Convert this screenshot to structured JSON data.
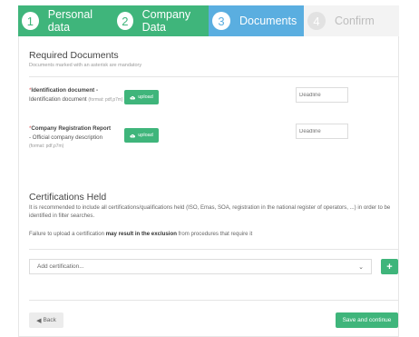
{
  "steps": [
    {
      "number": "1",
      "label": "Personal data",
      "state": "completed"
    },
    {
      "number": "2",
      "label": "Company Data",
      "state": "completed"
    },
    {
      "number": "3",
      "label": "Documents",
      "state": "active"
    },
    {
      "number": "4",
      "label": "Confirm",
      "state": "pending"
    }
  ],
  "colors": {
    "green": "#3fb57b",
    "blue": "#5aaee0",
    "grey": "#f3f3f3"
  },
  "required": {
    "title": "Required Documents",
    "subtitle": "Documents marked with an asterisk are mandatory",
    "documents": [
      {
        "asterisk": "*",
        "name": "Identification document",
        "dash": " -",
        "description": "Identification document",
        "format": "(format: pdf,p7m)",
        "upload_label": "upload",
        "upload_icon": "cloud-upload-icon",
        "deadline_placeholder": "Deadline"
      },
      {
        "asterisk": "*",
        "name": "Company Registration Report",
        "dash": "",
        "description": "- Official company description",
        "format": "(format: pdf,p7m)",
        "upload_label": "upload",
        "upload_icon": "cloud-upload-icon",
        "deadline_placeholder": "Deadline"
      }
    ]
  },
  "certifications": {
    "title": "Certifications Held",
    "recommendation": "It is recommended to include all certifications/qualifications held (ISO, Emas, SOA, registration in the national register of operators, ...) in order to be identified in filter searches.",
    "warning_prefix": "Failure to upload a certification ",
    "warning_bold": "may result in the exclusion",
    "warning_suffix": " from procedures that require it",
    "select_placeholder": "Add certification...",
    "chevron_icon": "chevron-down-icon",
    "add_label": "+"
  },
  "footer": {
    "back_icon": "circle-left-icon",
    "back_label": "Back",
    "save_label": "Save and continue"
  }
}
